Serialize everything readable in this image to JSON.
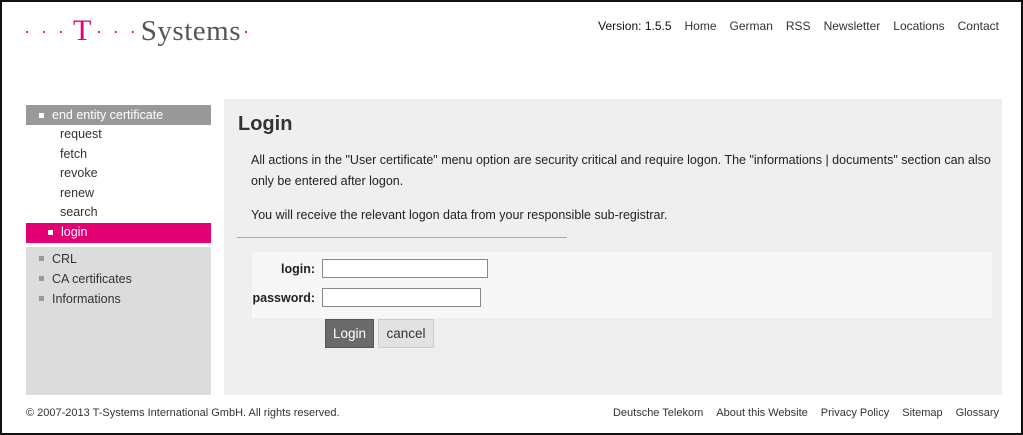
{
  "brand": {
    "dots_left": "· · ·",
    "t_letter": "T",
    "dots_mid": "· · ·",
    "name": "Systems",
    "dot_end": "·",
    "accent": "#e20074"
  },
  "topnav": {
    "version": "Version: 1.5.5",
    "links": [
      "Home",
      "German",
      "RSS",
      "Newsletter",
      "Locations",
      "Contact"
    ]
  },
  "sidebar": {
    "group_head": "end entity certificate",
    "sub_items": [
      "request",
      "fetch",
      "revoke",
      "renew",
      "search",
      "login"
    ],
    "active_sub": "login",
    "items": [
      "CRL",
      "CA certificates",
      "Informations"
    ]
  },
  "main": {
    "title": "Login",
    "paragraph1": "All actions in the \"User certificate\" menu option are security critical and require logon. The \"informations | documents\" section can also only be entered after logon.",
    "paragraph2": "You will receive the relevant logon data from your responsible sub-registrar.",
    "form": {
      "login_label": "login:",
      "login_value": "",
      "password_label": "password:",
      "password_value": "",
      "login_button": "Login",
      "cancel_button": "cancel"
    }
  },
  "footer": {
    "copyright": "© 2007-2013 T-Systems International GmbH. All rights reserved.",
    "links": [
      "Deutsche Telekom",
      "About this Website",
      "Privacy Policy",
      "Sitemap",
      "Glossary"
    ]
  }
}
